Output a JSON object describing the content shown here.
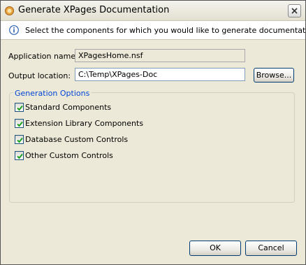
{
  "dialog": {
    "title": "Generate XPages Documentation",
    "info_text": "Select the components for which you would like to generate documentation"
  },
  "form": {
    "app_name_label": "Application name:",
    "app_name_value": "XPagesHome.nsf",
    "output_label": "Output location:",
    "output_value": "C:\\Temp\\XPages-Doc",
    "browse_label": "Browse..."
  },
  "options": {
    "group_label": "Generation Options",
    "items": [
      {
        "label": "Standard Components",
        "checked": true
      },
      {
        "label": "Extension Library Components",
        "checked": true
      },
      {
        "label": "Database Custom Controls",
        "checked": true
      },
      {
        "label": "Other Custom Controls",
        "checked": true
      }
    ]
  },
  "buttons": {
    "ok_label": "OK",
    "cancel_label": "Cancel"
  },
  "icons": {
    "app": "xpages-app-icon",
    "info": "info-icon",
    "close": "close-icon",
    "check": "checkmark-icon"
  },
  "colors": {
    "accent": "#0046d5",
    "check": "#21a121",
    "dialog_bg": "#ece9d8"
  }
}
